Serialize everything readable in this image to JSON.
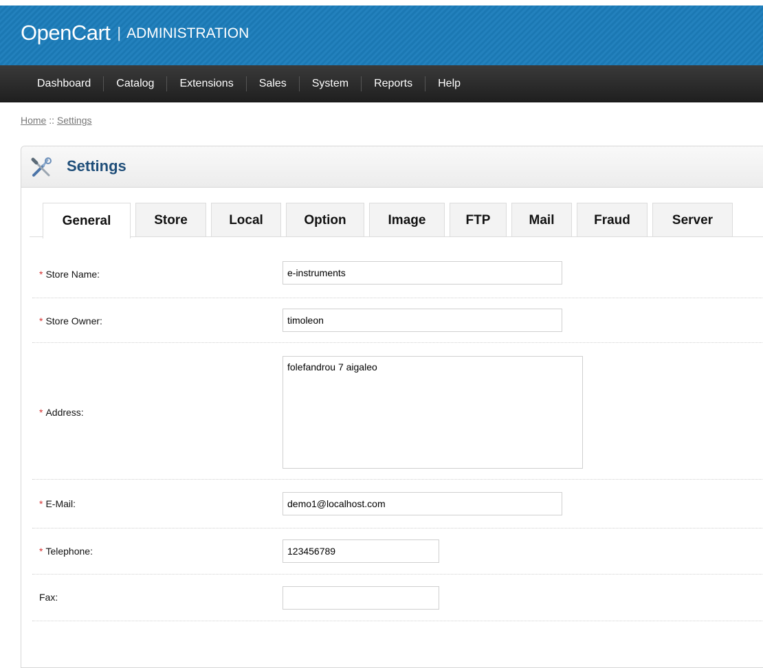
{
  "header": {
    "brand": "OpenCart",
    "separator": "|",
    "subtitle": "ADMINISTRATION"
  },
  "menu": {
    "items": [
      "Dashboard",
      "Catalog",
      "Extensions",
      "Sales",
      "System",
      "Reports",
      "Help"
    ]
  },
  "breadcrumb": {
    "home": "Home",
    "separator": " :: ",
    "current": "Settings"
  },
  "box": {
    "title": "Settings",
    "icon": "settings-tools-icon"
  },
  "tabs": {
    "active": "General",
    "items": [
      "General",
      "Store",
      "Local",
      "Option",
      "Image",
      "FTP",
      "Mail",
      "Fraud",
      "Server"
    ]
  },
  "form": {
    "required_marker": "*",
    "store_name": {
      "label": "Store Name:",
      "value": "e-instruments",
      "required": true
    },
    "store_owner": {
      "label": "Store Owner:",
      "value": "timoleon",
      "required": true
    },
    "address": {
      "label": "Address:",
      "value": "folefandrou 7 aigaleo",
      "required": true
    },
    "email": {
      "label": "E-Mail:",
      "value": "demo1@localhost.com",
      "required": true
    },
    "telephone": {
      "label": "Telephone:",
      "value": "123456789",
      "required": true
    },
    "fax": {
      "label": "Fax:",
      "value": "",
      "required": false
    }
  },
  "colors": {
    "header_blue": "#1d7ab5",
    "menu_dark": "#2a2a2a",
    "title_blue": "#1f4e79",
    "required_red": "#d32f2f"
  }
}
